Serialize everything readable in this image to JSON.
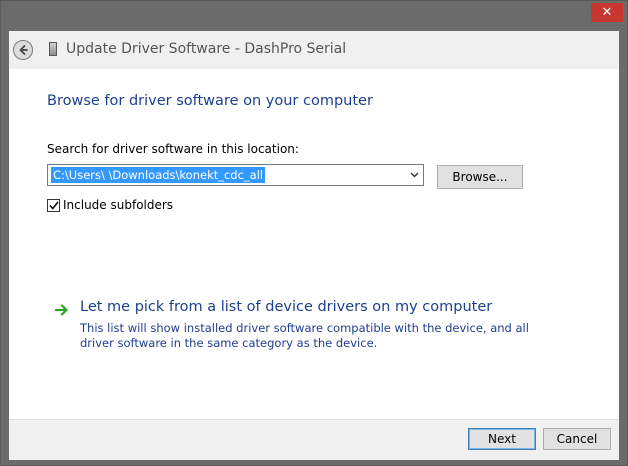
{
  "window": {
    "title": "Update Driver Software - DashPro Serial",
    "close_glyph": "✕"
  },
  "main": {
    "heading": "Browse for driver software on your computer",
    "search_label": "Search for driver software in this location:",
    "path_value": "C:\\Users\\        \\Downloads\\konekt_cdc_all",
    "browse_label": "Browse...",
    "include_subfolders_label": "Include subfolders",
    "include_subfolders_checked": true,
    "pick_link_title": "Let me pick from a list of device drivers on my computer",
    "pick_link_description": "This list will show installed driver software compatible with the device, and all driver software in the same category as the device."
  },
  "footer": {
    "next_label": "Next",
    "cancel_label": "Cancel"
  },
  "colors": {
    "heading_blue": "#1e3f8f",
    "selection_blue": "#3399ff",
    "close_red": "#c7372f",
    "arrow_green": "#2aa52a"
  },
  "icons": {
    "close": "close-icon",
    "back": "back-arrow-icon",
    "device": "device-icon",
    "dropdown": "chevron-down-icon",
    "check": "checkmark-icon",
    "link_arrow": "green-arrow-icon"
  }
}
